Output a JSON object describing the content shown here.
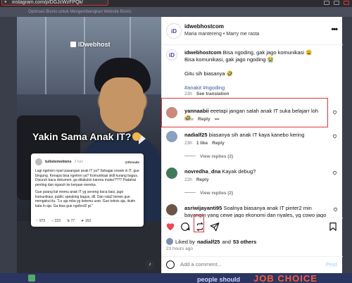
{
  "browser": {
    "url": "instagram.com/p/DGJcWzFPQk/"
  },
  "backdrop": {
    "top_text": "Optimasi Bisnis untuk Mengembangkan Website Bisnis",
    "bottom_text": "people should",
    "bottom_big": "JOB CHOICE"
  },
  "media": {
    "watermark": "IDwebhost",
    "caption": "Yakin Sama Anak IT?",
    "card": {
      "user": "tulistemotions",
      "time": "3 hari",
      "brand": "@threads",
      "paragraphs": [
        "Lagi ngetren nyari pasangan anak IT ya? Sebagai cewek in IT, gue bingung. Kenapa bisa ngetren ya? Komunikasi skill kurang bagus. Disuruh baca dokumen, ga dilakukin karena males???? Padahal penting dan ngaruh ke kerjaan mereka.",
        "Gue jarang liat memu anak IT yg seneng baca basi, jago komunikasi, public speaking bagus, dll. Dan rata2 temen gue mengakui itu. \"Lo aja mba yg ketemu user. Gue teknis aja, ikutin kata lo aja. Ga bisa gue ngobrol2 gt.\""
      ],
      "stats": [
        "973",
        "223",
        "77",
        "153"
      ]
    }
  },
  "panel": {
    "owner": {
      "username": "idwebhostcom",
      "subtitle": "Maria mantereng • Marry me rasta"
    },
    "caption_comment": {
      "username": "idwebhostcom",
      "line1": "Bisa ngoding, gak jago komunikasi",
      "line2": "Bisa komunikasi, gak jago ngoding",
      "line3": "Gitu sih biasanya",
      "tags": "#anakit #ngoding",
      "age": "23h",
      "action": "See translation"
    },
    "comments": [
      {
        "username": "yannaabii",
        "text": "eeetapi jangan salah anak IT suka belajarr loh",
        "age": "Now",
        "reply": "Reply",
        "extra": "•••",
        "avatar_color": "#c98a7a"
      },
      {
        "username": "nadialf25",
        "text": "biasanya sih anak IT kaya kanebo kering",
        "age": "23h",
        "likes": "1 like",
        "reply": "Reply",
        "view_replies": "View replies (2)",
        "avatar_color": "#8aa0c0"
      },
      {
        "username": "novredha_dna",
        "text": "Kayak debug?",
        "age": "22h",
        "reply": "Reply",
        "view_replies": "View replies (2)",
        "avatar_color": "#3f7a5a"
      },
      {
        "username": "asriwijayanti95",
        "text": "Soalnya biasanya anak IT pinter2 min bayangin yang cewe jago ekonomi dan nyales, yg cowo jago teknis IT fix",
        "avatar_color": "#6a5546"
      }
    ],
    "liked_by": {
      "prefix": "Liked by",
      "user": "nadialf25",
      "middle": "and",
      "others": "53 others"
    },
    "posted_ago": "23 hours ago",
    "add_comment_placeholder": "Add a comment...",
    "post_label": "Post"
  },
  "colors": {
    "highlight": "#e0373a",
    "like_red": "#ed4956",
    "link_blue": "#00376b"
  }
}
